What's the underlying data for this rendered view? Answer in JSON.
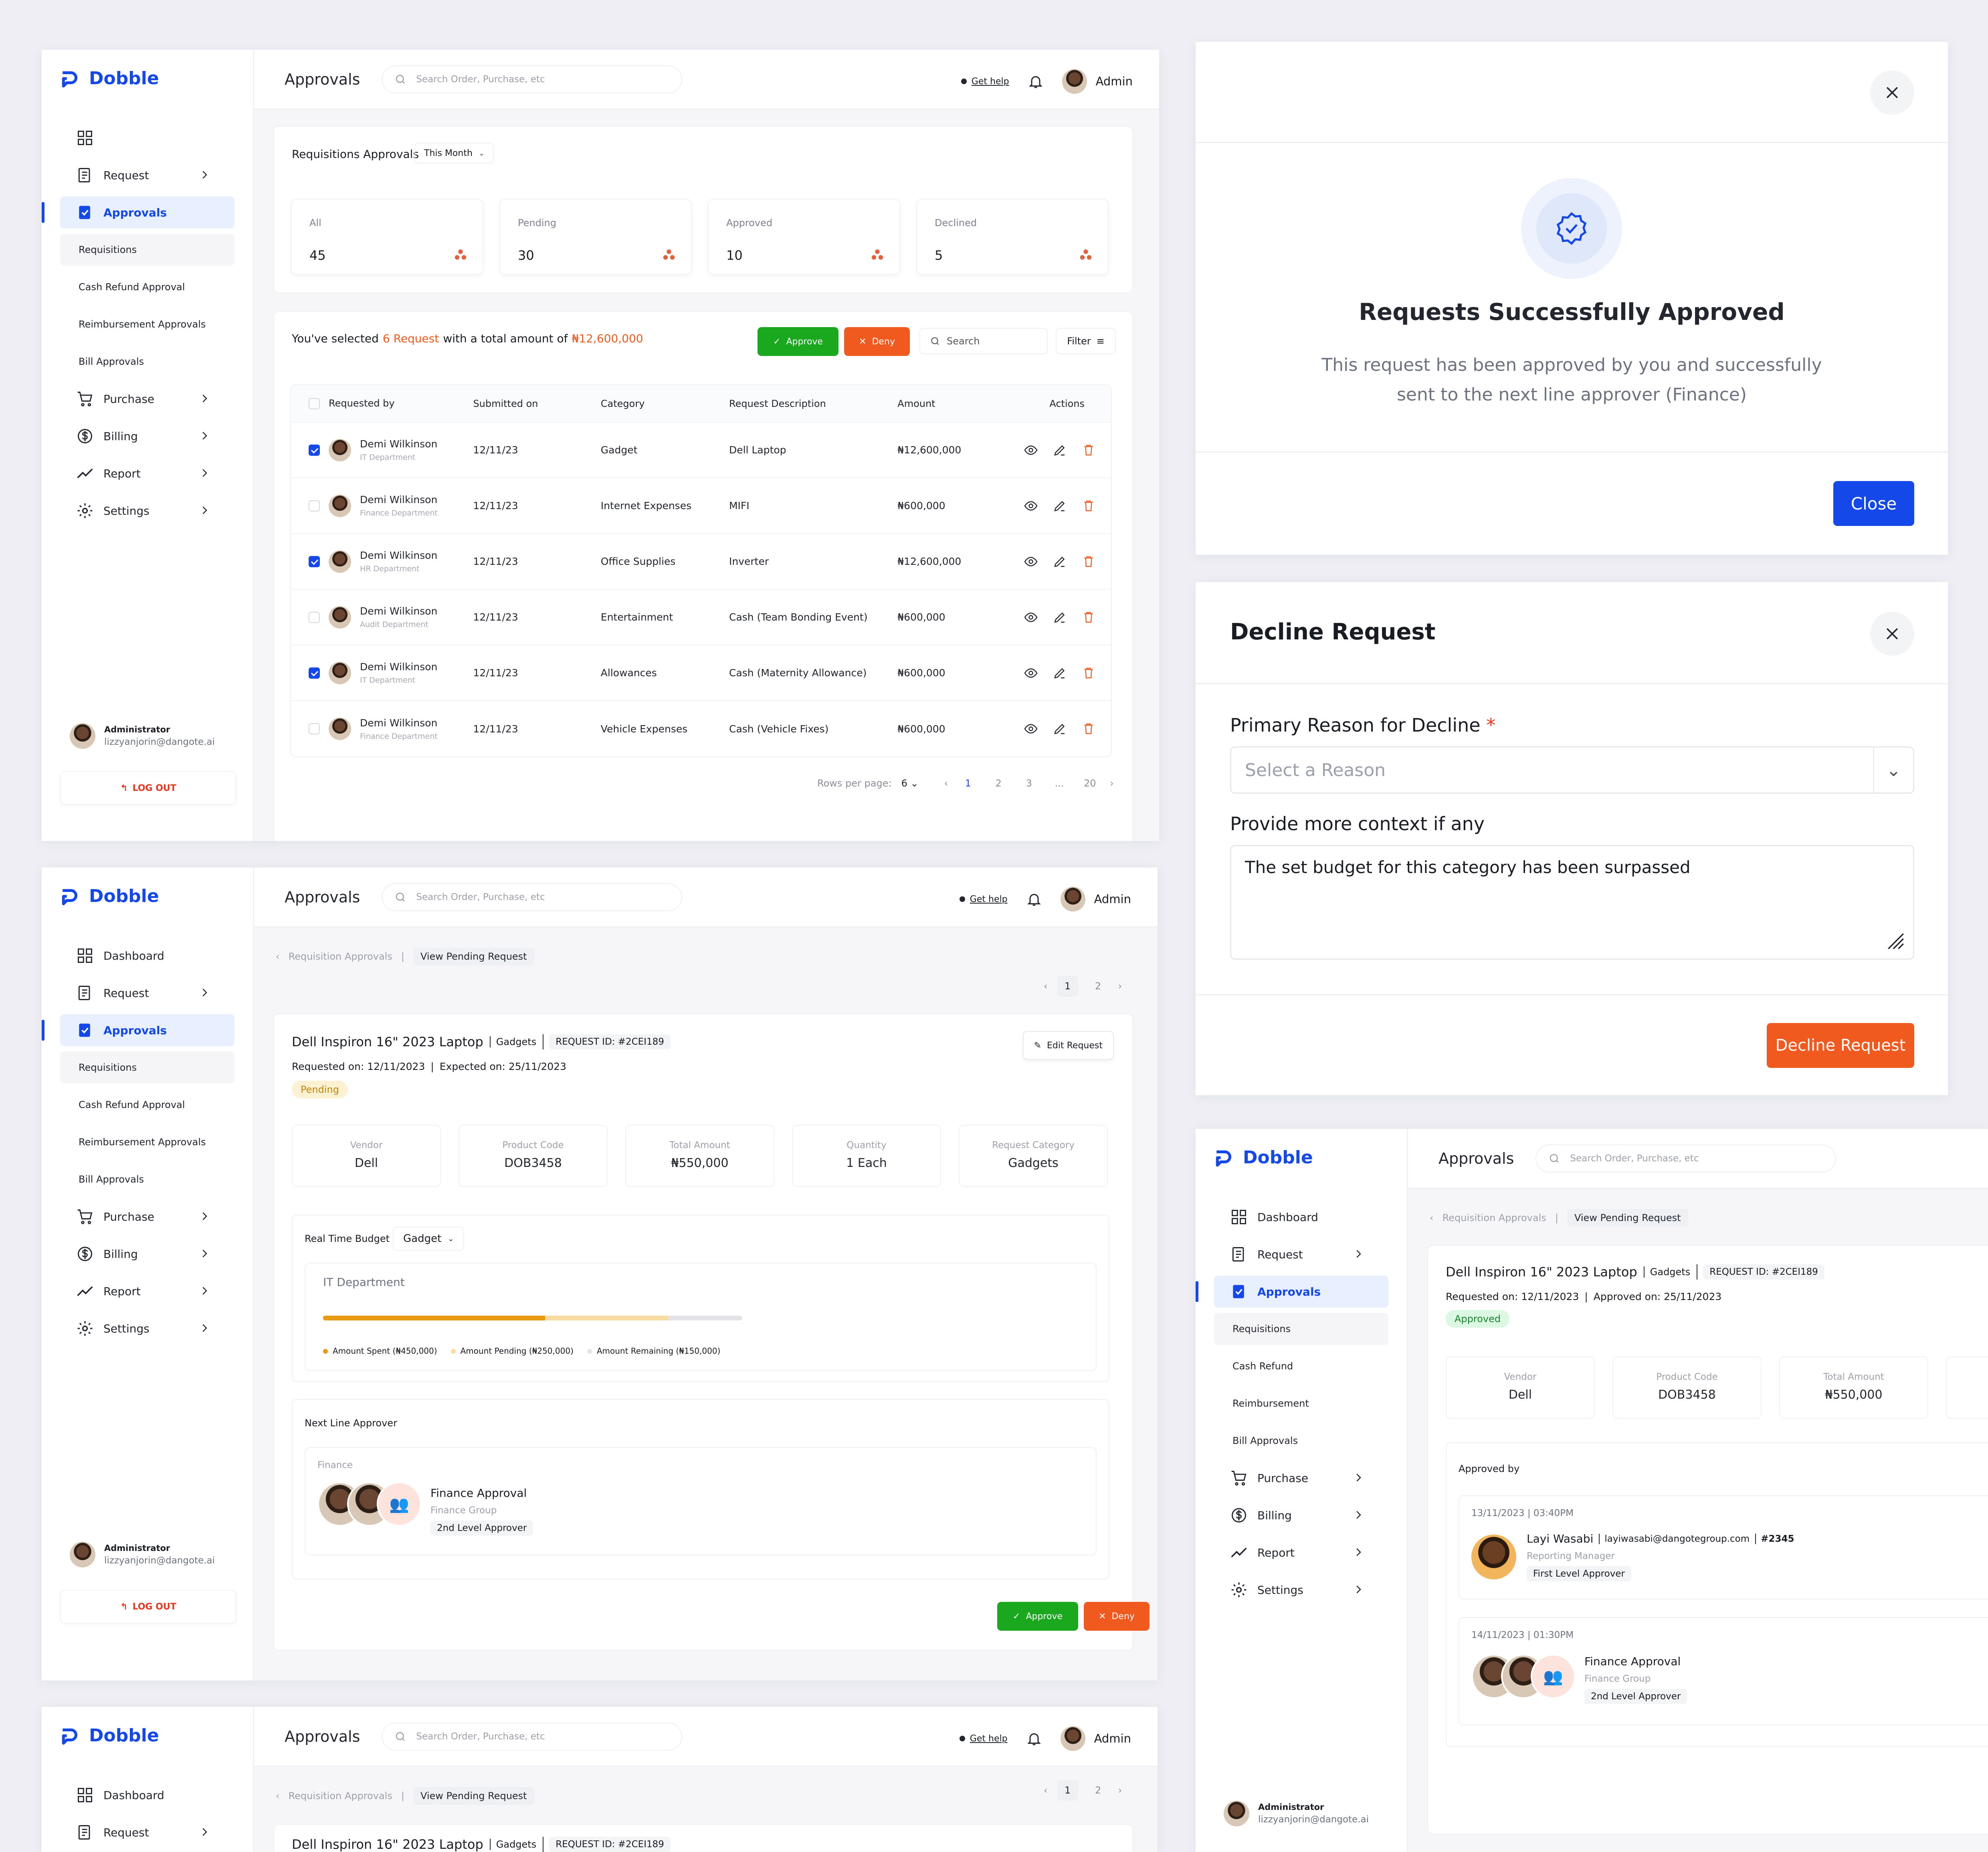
{
  "brand": "Dobble",
  "topbar": {
    "title": "Approvals",
    "search_placeholder": "Search Order, Purchase, etc",
    "help": "Get help",
    "user": "Admin"
  },
  "sidebar": {
    "dashboard": "Dashboard",
    "request": "Request",
    "approvals": "Approvals",
    "sub": [
      "Requisitions",
      "Cash Refund Approval",
      "Reimbursement Approvals",
      "Bill Approvals"
    ],
    "sub_short": [
      "Requisitions",
      "Cash Refund",
      "Reimbursement",
      "Bill Approvals"
    ],
    "purchase": "Purchase",
    "billing": "Billing",
    "report": "Report",
    "settings": "Settings",
    "role": "Administrator",
    "email": "lizzyanjorin@dangote.ai",
    "logout": "LOG OUT"
  },
  "list": {
    "heading": "Requisitions Approvals",
    "period": "This Month",
    "stats": [
      {
        "label": "All",
        "value": "45"
      },
      {
        "label": "Pending",
        "value": "30"
      },
      {
        "label": "Approved",
        "value": "10"
      },
      {
        "label": "Declined",
        "value": "5"
      }
    ],
    "sel_a": "You've selected",
    "sel_count": "6 Request",
    "sel_b": "with a total amount of",
    "sel_amount": "₦12,600,000",
    "approve": "Approve",
    "deny": "Deny",
    "search": "Search",
    "filter": "Filter",
    "columns": [
      "Requested by",
      "Submitted on",
      "Category",
      "Request Description",
      "Amount",
      "Actions"
    ],
    "rows": [
      {
        "name": "Demi Wilkinson",
        "dept": "IT Department",
        "date": "12/11/23",
        "cat": "Gadget",
        "desc": "Dell  Laptop",
        "amt": "₦12,600,000",
        "checked": true
      },
      {
        "name": "Demi Wilkinson",
        "dept": "Finance Department",
        "date": "12/11/23",
        "cat": "Internet Expenses",
        "desc": "MIFI",
        "amt": "₦600,000",
        "checked": false
      },
      {
        "name": "Demi Wilkinson",
        "dept": "HR Department",
        "date": "12/11/23",
        "cat": "Office Supplies",
        "desc": "Inverter",
        "amt": "₦12,600,000",
        "checked": true
      },
      {
        "name": "Demi Wilkinson",
        "dept": "Audit Department",
        "date": "12/11/23",
        "cat": "Entertainment",
        "desc": "Cash (Team Bonding Event)",
        "amt": "₦600,000",
        "checked": false
      },
      {
        "name": "Demi Wilkinson",
        "dept": "IT Department",
        "date": "12/11/23",
        "cat": "Allowances",
        "desc": "Cash (Maternity Allowance)",
        "amt": "₦600,000",
        "checked": true
      },
      {
        "name": "Demi Wilkinson",
        "dept": "Finance Department",
        "date": "12/11/23",
        "cat": "Vehicle Expenses",
        "desc": "Cash (Vehicle Fixes)",
        "amt": "₦600,000",
        "checked": false
      }
    ],
    "rows_per_page_label": "Rows per page:",
    "rows_per_page": "6",
    "pages": [
      "1",
      "2",
      "3",
      "...",
      "20"
    ]
  },
  "detail": {
    "crumb1": "Requisition Approvals",
    "crumb2": "View Pending Request",
    "pager": [
      "1",
      "2"
    ],
    "title": "Dell Inspiron 16\" 2023 Laptop",
    "category": "Gadgets",
    "request_id": "REQUEST ID: #2CEI189",
    "requested_on": "Requested on: 12/11/2023",
    "expected_on": "Expected on: 25/11/2023",
    "approved_on": "Approved on: 25/11/2023",
    "status": "Pending",
    "status_approved": "Approved",
    "edit": "Edit Request",
    "info": [
      {
        "label": "Vendor",
        "value": "Dell"
      },
      {
        "label": "Product Code",
        "value": "DOB3458"
      },
      {
        "label": "Total Amount",
        "value": "₦550,000"
      },
      {
        "label": "Quantity",
        "value": "1 Each"
      },
      {
        "label": "Request Category",
        "value": "Gadgets"
      }
    ],
    "budget_label": "Real Time Budget",
    "budget_select": "Gadget",
    "department": "IT Department",
    "budget": {
      "spent": 450000,
      "pending": 250000,
      "remaining": 150000
    },
    "legend": [
      "Amount Spent (₦450,000)",
      "Amount Pending (₦250,000)",
      "Amount Remaining (₦150,000)"
    ],
    "next_approver": "Next Line Approver",
    "group": "Finance",
    "approval_name": "Finance Approval",
    "approval_group": "Finance Group",
    "approval_level": "2nd Level Approver",
    "approve": "Approve",
    "deny": "Deny"
  },
  "approved_by": {
    "label": "Approved by",
    "first_time": "13/11/2023 | 03:40PM",
    "first_name": "Layi Wasabi",
    "first_email": "layiwasabi@dangotegroup.com",
    "first_id": "#2345",
    "first_role": "Reporting Manager",
    "first_level": "First Level Approver",
    "second_time": "14/11/2023 | 01:30PM"
  },
  "success_modal": {
    "title": "Requests Successfully Approved",
    "body1": "This request has been approved by you and successfully",
    "body2": "sent to the next line approver (Finance)",
    "close": "Close"
  },
  "decline_modal": {
    "title": "Decline Request",
    "reason_label": "Primary Reason for Decline",
    "required": "*",
    "reason_placeholder": "Select a Reason",
    "context_label": "Provide more context if any",
    "context_value": "The set budget for this category has been surpassed",
    "submit": "Decline Request"
  },
  "colors": {
    "brand": "#1548e8",
    "approve": "#1aa81e",
    "deny": "#f05a1e",
    "spent": "#e89a12",
    "pending": "#f8dba0",
    "remaining": "#e4e4e8"
  }
}
